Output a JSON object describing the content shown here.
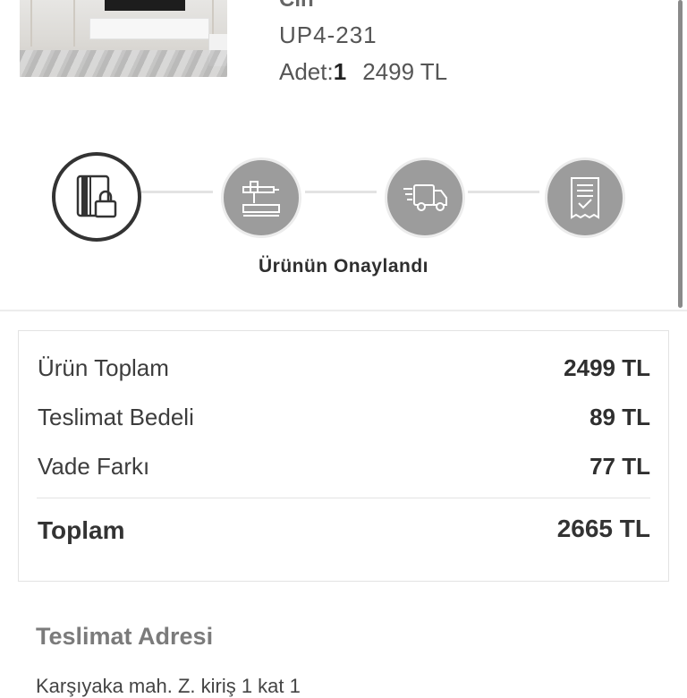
{
  "product": {
    "name_partial": "Cin",
    "code": "UP4-231",
    "qty_label": "Adet:",
    "qty_value": "1",
    "price": "2499 TL",
    "image_icon": "tv-unit-room-photo"
  },
  "progress": {
    "steps": [
      {
        "icon": "credit-card-lock-icon",
        "state": "active"
      },
      {
        "icon": "workbench-tools-icon",
        "state": "pending"
      },
      {
        "icon": "delivery-truck-icon",
        "state": "pending"
      },
      {
        "icon": "receipt-check-icon",
        "state": "pending"
      }
    ],
    "current_label": "Ürünün Onaylandı"
  },
  "summary": {
    "rows": [
      {
        "label": "Ürün Toplam",
        "value": "2499 TL"
      },
      {
        "label": "Teslimat Bedeli",
        "value": "89 TL"
      },
      {
        "label": "Vade Farkı",
        "value": "77 TL"
      }
    ],
    "total_label": "Toplam",
    "total_value": "2665 TL"
  },
  "address": {
    "title": "Teslimat Adresi",
    "line1_partial": "Karşıyaka mah.    Z. kiriş 1 kat 1"
  },
  "colors": {
    "active_step_border": "#333333",
    "pending_step_fill": "#9c9c9c",
    "connector": "#e3e3e3"
  }
}
